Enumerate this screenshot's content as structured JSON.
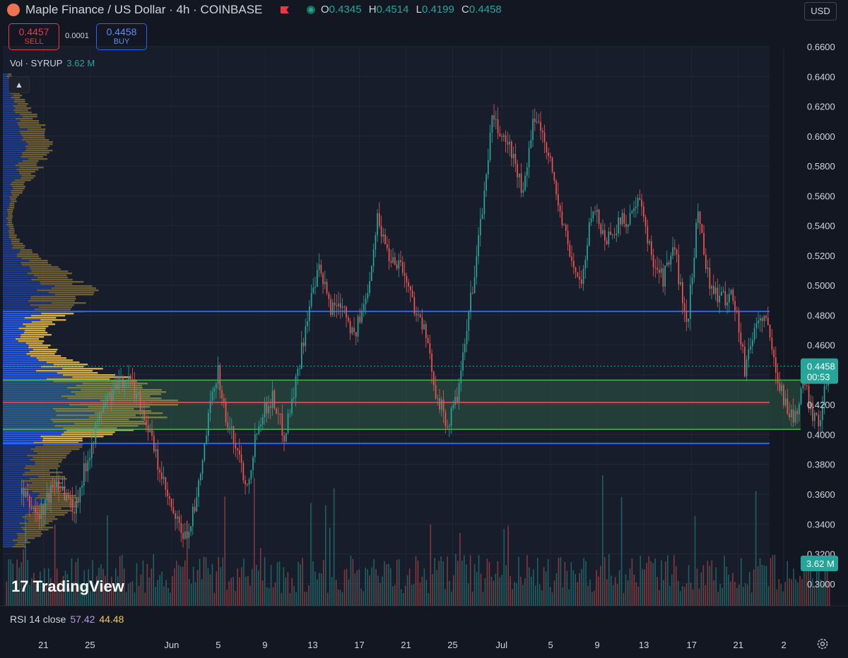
{
  "header": {
    "title": "Maple Finance / US Dollar · 4h · COINBASE",
    "ohlc": [
      {
        "k": "O",
        "v": "0.4345"
      },
      {
        "k": "H",
        "v": "0.4514"
      },
      {
        "k": "L",
        "v": "0.4199"
      },
      {
        "k": "C",
        "v": "0.4458"
      }
    ],
    "currency": "USD"
  },
  "trade": {
    "sell_price": "0.4457",
    "sell_label": "SELL",
    "spread": "0.0001",
    "buy_price": "0.4458",
    "buy_label": "BUY"
  },
  "volume_legend": {
    "label": "Vol · SYRUP",
    "value": "3.62 M"
  },
  "watermark": "TradingView",
  "rsi_legend": {
    "label": "RSI 14 close",
    "v1": "57.42",
    "v2": "44.48"
  },
  "colors": {
    "background": "#131722",
    "up": "#26a69a",
    "down": "#ef5350",
    "blue_line": "#2962ff",
    "red_line": "#f23645",
    "green_zone": "#4caf50",
    "profile_up": "#f5c342",
    "profile_down": "#2962ff"
  },
  "chart_data": {
    "type": "candlestick",
    "symbol": "SYRUP/USD",
    "interval": "4h",
    "ylim": [
      0.29,
      0.66
    ],
    "y_ticks": [
      "0.6600",
      "0.6400",
      "0.6200",
      "0.6000",
      "0.5800",
      "0.5600",
      "0.5400",
      "0.5200",
      "0.5000",
      "0.4800",
      "0.4600",
      "0.4400",
      "0.4200",
      "0.4000",
      "0.3800",
      "0.3600",
      "0.3400",
      "0.3200",
      "0.3000"
    ],
    "x_ticks": [
      "21",
      "25",
      "Jun",
      "5",
      "9",
      "13",
      "17",
      "21",
      "25",
      "Jul",
      "5",
      "9",
      "13",
      "17",
      "21",
      "2"
    ],
    "last_price": {
      "value": 0.4458,
      "label": "0.4458",
      "countdown": "00:53"
    },
    "volume_label": "3.62 M",
    "horizontal_lines": [
      {
        "price": 0.4825,
        "color": "blue"
      },
      {
        "price": 0.4215,
        "color": "red"
      },
      {
        "price": 0.394,
        "color": "blue"
      }
    ],
    "zone": {
      "top": 0.4365,
      "bottom": 0.4035
    },
    "price_path": [
      {
        "d": 0,
        "p": 0.36
      },
      {
        "d": 1.5,
        "p": 0.345
      },
      {
        "d": 3,
        "p": 0.37
      },
      {
        "d": 4.5,
        "p": 0.35
      },
      {
        "d": 6,
        "p": 0.395
      },
      {
        "d": 7,
        "p": 0.42
      },
      {
        "d": 8,
        "p": 0.43
      },
      {
        "d": 9,
        "p": 0.44
      },
      {
        "d": 10,
        "p": 0.425
      },
      {
        "d": 11,
        "p": 0.4
      },
      {
        "d": 12,
        "p": 0.37
      },
      {
        "d": 13,
        "p": 0.345
      },
      {
        "d": 14,
        "p": 0.33
      },
      {
        "d": 15,
        "p": 0.355
      },
      {
        "d": 16,
        "p": 0.41
      },
      {
        "d": 16.8,
        "p": 0.445
      },
      {
        "d": 17.5,
        "p": 0.41
      },
      {
        "d": 18.5,
        "p": 0.39
      },
      {
        "d": 19.3,
        "p": 0.365
      },
      {
        "d": 20.3,
        "p": 0.41
      },
      {
        "d": 21.5,
        "p": 0.425
      },
      {
        "d": 22.5,
        "p": 0.4
      },
      {
        "d": 23.5,
        "p": 0.435
      },
      {
        "d": 24.5,
        "p": 0.48
      },
      {
        "d": 25.5,
        "p": 0.51
      },
      {
        "d": 26.5,
        "p": 0.485
      },
      {
        "d": 27.5,
        "p": 0.49
      },
      {
        "d": 28.5,
        "p": 0.465
      },
      {
        "d": 29.5,
        "p": 0.49
      },
      {
        "d": 30.5,
        "p": 0.545
      },
      {
        "d": 31.5,
        "p": 0.52
      },
      {
        "d": 32.5,
        "p": 0.515
      },
      {
        "d": 33.5,
        "p": 0.49
      },
      {
        "d": 34.5,
        "p": 0.47
      },
      {
        "d": 35.5,
        "p": 0.43
      },
      {
        "d": 36.5,
        "p": 0.405
      },
      {
        "d": 37.5,
        "p": 0.43
      },
      {
        "d": 38.5,
        "p": 0.49
      },
      {
        "d": 39.5,
        "p": 0.55
      },
      {
        "d": 40.3,
        "p": 0.61
      },
      {
        "d": 41.2,
        "p": 0.6
      },
      {
        "d": 42,
        "p": 0.59
      },
      {
        "d": 43,
        "p": 0.56
      },
      {
        "d": 44,
        "p": 0.615
      },
      {
        "d": 45,
        "p": 0.595
      },
      {
        "d": 46,
        "p": 0.555
      },
      {
        "d": 47,
        "p": 0.52
      },
      {
        "d": 48,
        "p": 0.5
      },
      {
        "d": 49,
        "p": 0.555
      },
      {
        "d": 50,
        "p": 0.53
      },
      {
        "d": 51,
        "p": 0.54
      },
      {
        "d": 52,
        "p": 0.545
      },
      {
        "d": 53,
        "p": 0.555
      },
      {
        "d": 54,
        "p": 0.52
      },
      {
        "d": 55,
        "p": 0.505
      },
      {
        "d": 56,
        "p": 0.525
      },
      {
        "d": 57,
        "p": 0.47
      },
      {
        "d": 58,
        "p": 0.55
      },
      {
        "d": 59,
        "p": 0.5
      },
      {
        "d": 60,
        "p": 0.49
      },
      {
        "d": 61,
        "p": 0.495
      },
      {
        "d": 62,
        "p": 0.445
      },
      {
        "d": 63,
        "p": 0.475
      },
      {
        "d": 63.7,
        "p": 0.48
      },
      {
        "d": 64.5,
        "p": 0.45
      },
      {
        "d": 65.5,
        "p": 0.42
      },
      {
        "d": 66.3,
        "p": 0.41
      },
      {
        "d": 67,
        "p": 0.435
      },
      {
        "d": 67.8,
        "p": 0.415
      },
      {
        "d": 68.5,
        "p": 0.41
      },
      {
        "d": 69.2,
        "p": 0.445
      }
    ]
  }
}
